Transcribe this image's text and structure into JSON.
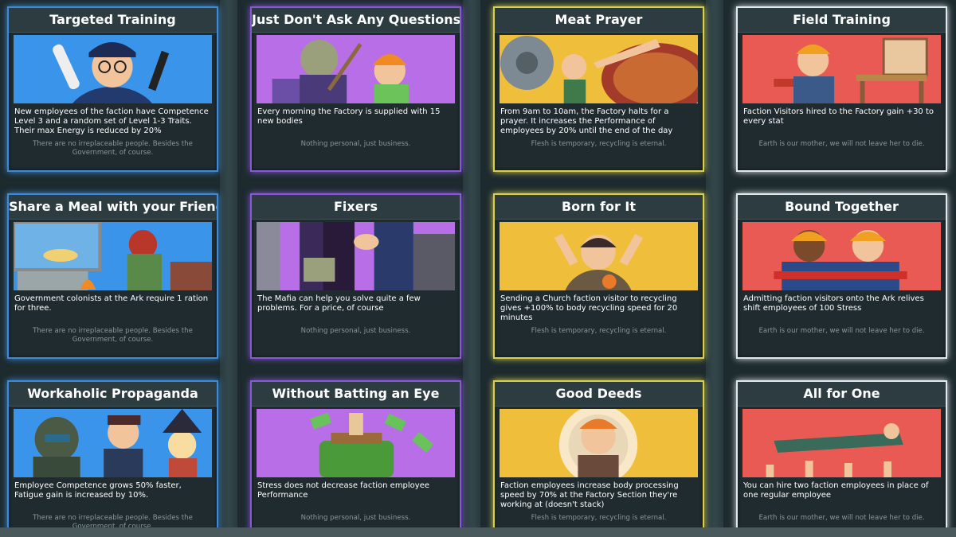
{
  "cards": [
    {
      "title": "Targeted Training",
      "icon": "police-officer-art",
      "color": "#3a95ea",
      "description": "New employees of the faction have Competence Level 3 and a random set of Level 1-3 Traits. Their max Energy is reduced by 20%",
      "flavor": "There are no irreplaceable people. Besides the Government, of course."
    },
    {
      "title": "Just Don't Ask Any Questions",
      "icon": "worker-with-mop-art",
      "color": "#b76ee6",
      "description": "Every morning the Factory is supplied with 15 new bodies",
      "flavor": "Nothing personal, just business."
    },
    {
      "title": "Meat Prayer",
      "icon": "meat-grinder-art",
      "color": "#efbf3c",
      "description": "From 9am to 10am, the Factory halts for a prayer. It increases the Performance of employees by 20% until the end of the day",
      "flavor": "Flesh is temporary, recycling is eternal."
    },
    {
      "title": "Field Training",
      "icon": "worker-at-workbench-art",
      "color": "#ea5a55",
      "description": "Faction Visitors hired to the Factory gain +30 to every stat",
      "flavor": "Earth is our mother, we will not leave her to die."
    },
    {
      "title": "Share a Meal with your Friend",
      "icon": "rat-and-pancakes-art",
      "color": "#3a95ea",
      "description": "Government colonists at the Ark require 1 ration for three.",
      "flavor": "There are no irreplaceable people. Besides the Government, of course."
    },
    {
      "title": "Fixers",
      "icon": "mafia-handshake-art",
      "color": "#b76ee6",
      "description": "The Mafia can help you solve quite a few problems. For a price, of course",
      "flavor": "Nothing personal, just business."
    },
    {
      "title": "Born for It",
      "icon": "cheering-kid-art",
      "color": "#efbf3c",
      "description": "Sending a Church faction visitor to recycling gives +100% to body recycling speed for 20 minutes",
      "flavor": "Flesh is temporary, recycling is eternal."
    },
    {
      "title": "Bound Together",
      "icon": "two-workers-art",
      "color": "#ea5a55",
      "description": "Admitting faction visitors onto the Ark relives shift employees of 100 Stress",
      "flavor": "Earth is our mother, we will not leave her to die."
    },
    {
      "title": "Workaholic Propaganda",
      "icon": "soldier-group-art",
      "color": "#3a95ea",
      "description": "Employee Competence grows 50% faster, Fatigue gain is increased by 10%.",
      "flavor": "There are no irreplaceable people. Besides the Government, of course."
    },
    {
      "title": "Without Batting an Eye",
      "icon": "money-bundle-art",
      "color": "#b76ee6",
      "description": "Stress does not decrease faction employee Performance",
      "flavor": "Nothing personal, just business."
    },
    {
      "title": "Good Deeds",
      "icon": "kid-with-plate-art",
      "color": "#efbf3c",
      "description": "Faction employees increase body processing speed by 70% at the Factory Section they're working at (doesn't stack)",
      "flavor": "Flesh is temporary, recycling is eternal."
    },
    {
      "title": "All for One",
      "icon": "crowd-surfing-art",
      "color": "#ea5a55",
      "description": "You can hire two faction employees in place of one regular employee",
      "flavor": "Earth is our mother, we will not leave her to die."
    }
  ]
}
